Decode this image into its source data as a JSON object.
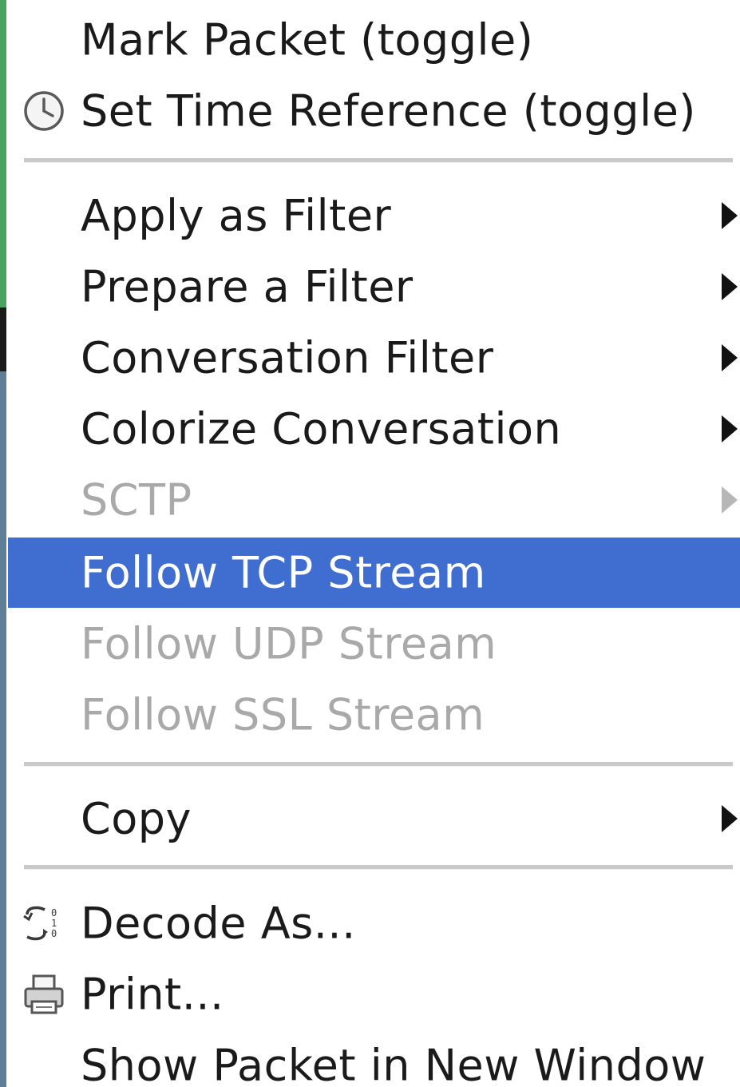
{
  "menu": {
    "mark_packet": "Mark Packet (toggle)",
    "set_time_reference": "Set Time Reference (toggle)",
    "apply_as_filter": "Apply as Filter",
    "prepare_a_filter": "Prepare a Filter",
    "conversation_filter": "Conversation Filter",
    "colorize_conversation": "Colorize Conversation",
    "sctp": "SCTP",
    "follow_tcp_stream": "Follow TCP Stream",
    "follow_udp_stream": "Follow UDP Stream",
    "follow_ssl_stream": "Follow SSL Stream",
    "copy": "Copy",
    "decode_as": "Decode As...",
    "print": "Print...",
    "show_packet_in_new_window": "Show Packet in New Window"
  },
  "icons": {
    "set_time_reference": "clock-icon",
    "decode_as": "decode-as-icon",
    "print": "printer-icon",
    "submenu": "submenu-arrow-icon"
  },
  "colors": {
    "highlight": "#3f6ed0",
    "disabled_text": "#a9a9a9",
    "text": "#1a1a1a"
  }
}
